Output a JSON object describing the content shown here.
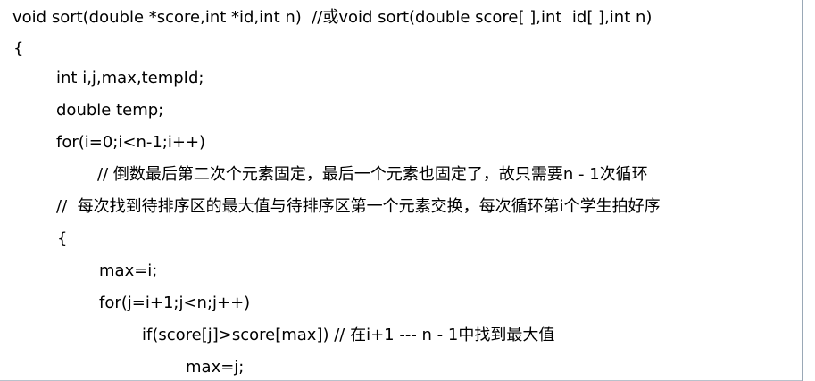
{
  "code": {
    "lines": [
      "void sort(double *score,int *id,int n)  //或void sort(double score[ ],int  id[ ],int n)",
      "{",
      "int i,j,max,tempId;",
      "double temp;",
      "for(i=0;i<n-1;i++)",
      "// 倒数最后第二次个元素固定，最后一个元素也固定了，故只需要n - 1次循环",
      "//  每次找到待排序区的最大值与待排序区第一个元素交换，每次循环第i个学生拍好序",
      "{",
      "max=i;",
      "for(j=i+1;j<n;j++)",
      "if(score[j]>score[max]) // 在i+1 --- n - 1中找到最大值",
      "max=j;"
    ]
  }
}
